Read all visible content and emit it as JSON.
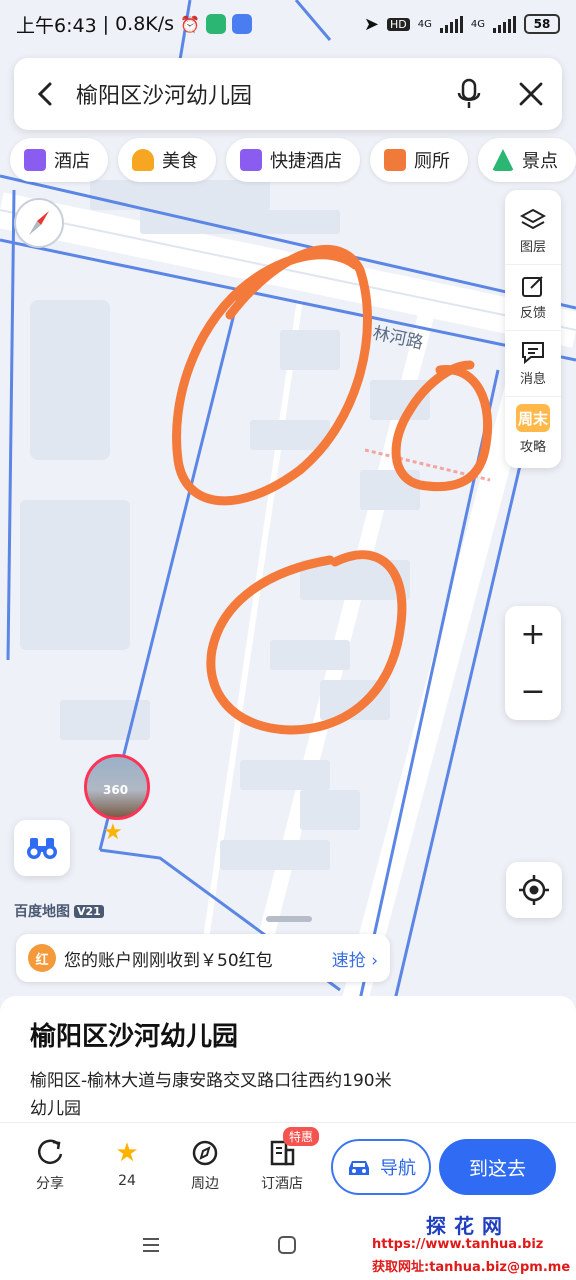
{
  "status_bar": {
    "time": "上午6:43",
    "speed": "0.8K/s",
    "network_1": "4G",
    "network_2": "4G",
    "hd_label": "HD",
    "battery": "58"
  },
  "search": {
    "query": "榆阳区沙河幼儿园"
  },
  "chips": [
    {
      "label": "酒店",
      "icon": "hotel-icon",
      "color": "#8a5cf0"
    },
    {
      "label": "美食",
      "icon": "food-icon",
      "color": "#f7a621"
    },
    {
      "label": "快捷酒店",
      "icon": "budget-hotel-icon",
      "color": "#8a5cf0"
    },
    {
      "label": "厕所",
      "icon": "toilet-icon",
      "color": "#f07a3a"
    },
    {
      "label": "景点",
      "icon": "scenic-icon",
      "color": "#2bb673"
    }
  ],
  "toolbar": {
    "layers": "图层",
    "feedback": "反馈",
    "messages": "消息",
    "weekend_badge": "周末",
    "guide": "攻略"
  },
  "map": {
    "road_label": "林河路",
    "logo": "百度地图",
    "logo_version": "V21",
    "streetview_badge": "360"
  },
  "banner": {
    "icon_text": "红",
    "text": "您的账户刚刚收到￥50红包",
    "action": "速抢"
  },
  "place": {
    "title": "榆阳区沙河幼儿园",
    "address": "榆阳区-榆林大道与康安路交叉路口往西约190米",
    "type": "幼儿园"
  },
  "actions": {
    "share": "分享",
    "favorites": "24",
    "nearby": "周边",
    "book_hotel": "订酒店",
    "special_tag": "特惠",
    "navigate": "导航",
    "go_here": "到这去"
  },
  "watermark": {
    "brand": "探花网",
    "url": "https://www.tanhua.biz",
    "email": "获取网址:tanhua.biz@pm.me"
  },
  "colors": {
    "accent": "#2f6cf3",
    "annotation": "#f47a3c",
    "boundary": "#4a7ee8"
  }
}
